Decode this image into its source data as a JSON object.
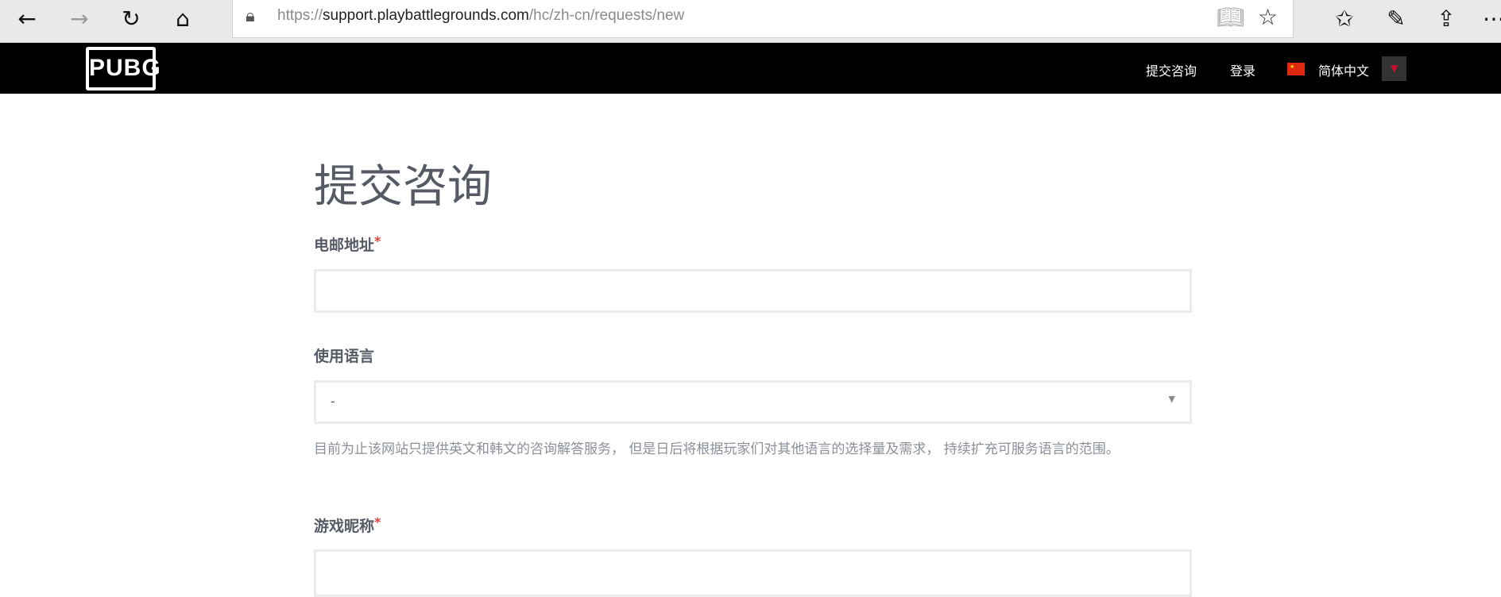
{
  "browser": {
    "url_prefix": "https://",
    "url_domain": "support.playbattlegrounds.com",
    "url_path": "/hc/zh-cn/requests/new",
    "icons": [
      "back-icon",
      "forward-icon",
      "refresh-icon",
      "home-icon",
      "lock-icon",
      "reading-view-icon",
      "favorite-star-icon",
      "favorites-list-icon",
      "pen-icon",
      "share-icon",
      "more-icon"
    ]
  },
  "header": {
    "logo": "PUBG",
    "nav_submit": "提交咨询",
    "nav_login": "登录",
    "language": "简体中文"
  },
  "page": {
    "title": "提交咨询",
    "email_label": "电邮地址",
    "email_value": "",
    "required_mark": "*",
    "language_label": "使用语言",
    "language_value": "-",
    "language_help": "目前为止该网站只提供英文和韩文的咨询解答服务， 但是日后将根据玩家们对其他语言的选择量及需求， 持续扩充可服务语言的范围。",
    "nickname_label": "游戏昵称",
    "nickname_value": ""
  },
  "colors": {
    "header_bg": "#000000",
    "required": "#e3413b",
    "text": "#555a64"
  }
}
